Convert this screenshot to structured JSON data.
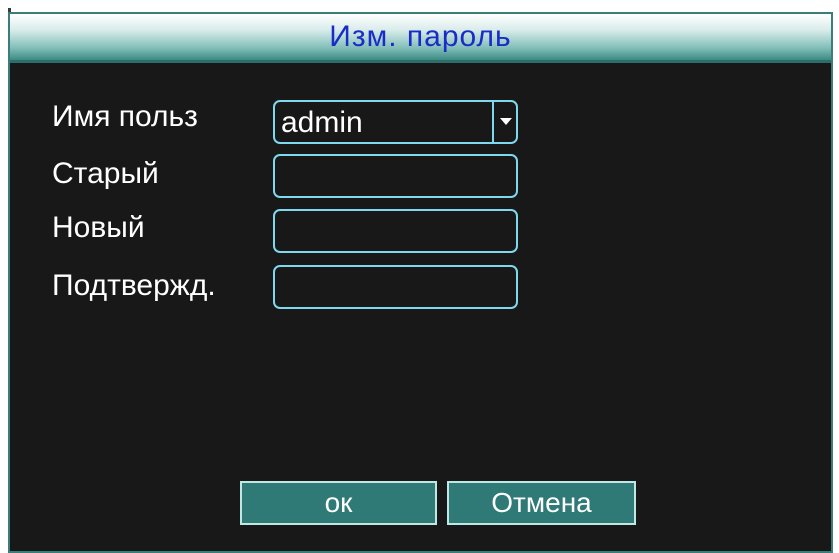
{
  "dialog": {
    "title": "Изм. пароль"
  },
  "form": {
    "user_label": "Имя польз",
    "user_value": "admin",
    "old_label": "Старый",
    "new_label": "Новый",
    "confirm_label": "Подтвержд."
  },
  "buttons": {
    "ok_label": "ок",
    "cancel_label": "Отмена"
  },
  "icons": {
    "dropdown": "chevron-down-icon"
  },
  "colors": {
    "title_text": "#1a2cc8",
    "field_border": "#7ed8ee",
    "button_fill": "#2f7a76",
    "background": "#181818"
  }
}
